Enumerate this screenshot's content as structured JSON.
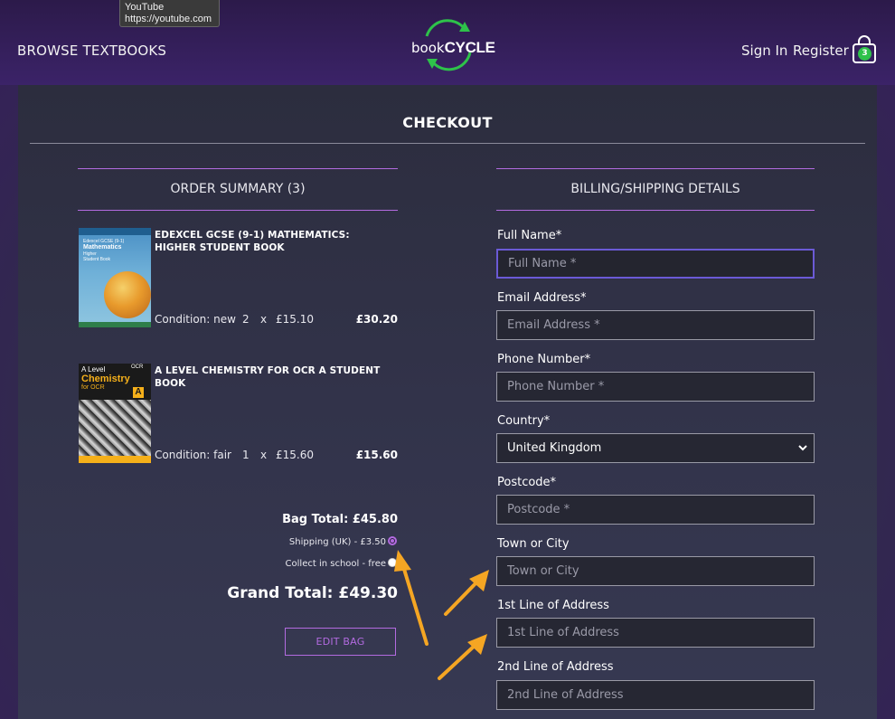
{
  "tooltip": {
    "line1": "YouTube",
    "line2": "https://youtube.com"
  },
  "header": {
    "browse_label": "BROWSE TEXTBOOKS",
    "logo_word_light": "book",
    "logo_word_bold": "CYCLE",
    "sign_in_label": "Sign In",
    "register_label": "Register",
    "bag_count": "3"
  },
  "page": {
    "title": "CHECKOUT"
  },
  "order_summary": {
    "title": "ORDER SUMMARY (3)",
    "items": [
      {
        "title": "EDEXCEL GCSE (9-1) MATHEMATICS: HIGHER STUDENT BOOK",
        "condition": "Condition: new",
        "qty": "2",
        "times": "x",
        "unit_price": "£15.10",
        "line_total": "£30.20",
        "cover_lines": [
          "Edexcel GCSE (9-1)",
          "Mathematics",
          "Higher",
          "Student Book"
        ]
      },
      {
        "title": "A LEVEL CHEMISTRY FOR OCR A STUDENT BOOK",
        "condition": "Condition: fair",
        "qty": "1",
        "times": "x",
        "unit_price": "£15.60",
        "line_total": "£15.60",
        "cover_lines": [
          "A Level",
          "Chemistry",
          "for OCR",
          "A",
          "OCR"
        ]
      }
    ],
    "bag_total": "Bag Total: £45.80",
    "shipping_options": [
      {
        "label": "Shipping (UK) - £3.50",
        "selected": true
      },
      {
        "label": "Collect in school - free",
        "selected": false
      }
    ],
    "grand_total": "Grand Total: £49.30",
    "edit_bag_label": "EDIT BAG"
  },
  "billing": {
    "title": "BILLING/SHIPPING DETAILS",
    "fields": {
      "full_name": {
        "label": "Full Name*",
        "placeholder": "Full Name *"
      },
      "email": {
        "label": "Email Address*",
        "placeholder": "Email Address *"
      },
      "phone": {
        "label": "Phone Number*",
        "placeholder": "Phone Number *"
      },
      "country": {
        "label": "Country*",
        "value": "United Kingdom"
      },
      "postcode": {
        "label": "Postcode*",
        "placeholder": "Postcode *"
      },
      "town": {
        "label": "Town or City",
        "placeholder": "Town or City"
      },
      "address1": {
        "label": "1st Line of Address",
        "placeholder": "1st Line of Address"
      },
      "address2": {
        "label": "2nd Line of Address",
        "placeholder": "2nd Line of Address"
      }
    }
  },
  "colors": {
    "accent_purple": "#b36be0",
    "focus_blue": "#6b5ad6",
    "annotation_orange": "#f5a623",
    "bag_badge_green": "#2ec24a"
  }
}
